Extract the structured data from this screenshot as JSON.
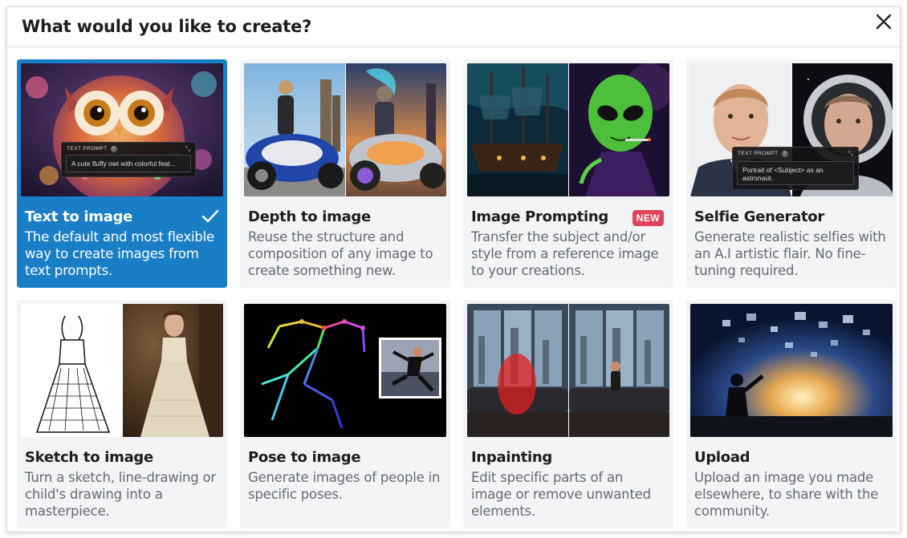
{
  "dialog": {
    "title": "What would you like to create?",
    "close_icon": "close-icon"
  },
  "cards": [
    {
      "title": "Text to image",
      "description": "The default and most flexible way to create images from text prompts.",
      "selected": true,
      "prompt": {
        "label": "TEXT PROMPT",
        "help": "?",
        "value": "A cute fluffy owl with colorful feat..."
      }
    },
    {
      "title": "Depth to image",
      "description": "Reuse the structure and composition of any image to create something new."
    },
    {
      "title": "Image Prompting",
      "description": "Transfer the subject and/or style from a reference image to your creations.",
      "badge": "NEW"
    },
    {
      "title": "Selfie Generator",
      "description": "Generate realistic selfies with an A.I artistic flair. No fine-tuning required.",
      "prompt": {
        "label": "TEXT PROMPT",
        "help": "?",
        "value": "Portrait of <Subject> as an astronaut."
      }
    },
    {
      "title": "Sketch to image",
      "description": "Turn a sketch, line-drawing or child's drawing into a masterpiece."
    },
    {
      "title": "Pose to image",
      "description": "Generate images of people in specific poses."
    },
    {
      "title": "Inpainting",
      "description": "Edit specific parts of an image or remove unwanted elements."
    },
    {
      "title": "Upload",
      "description": "Upload an image you made elsewhere, to share with the community."
    }
  ],
  "colors": {
    "selected_card": "#1a7ec6",
    "card_bg": "#f3f4f6",
    "badge": "#e0445a"
  }
}
